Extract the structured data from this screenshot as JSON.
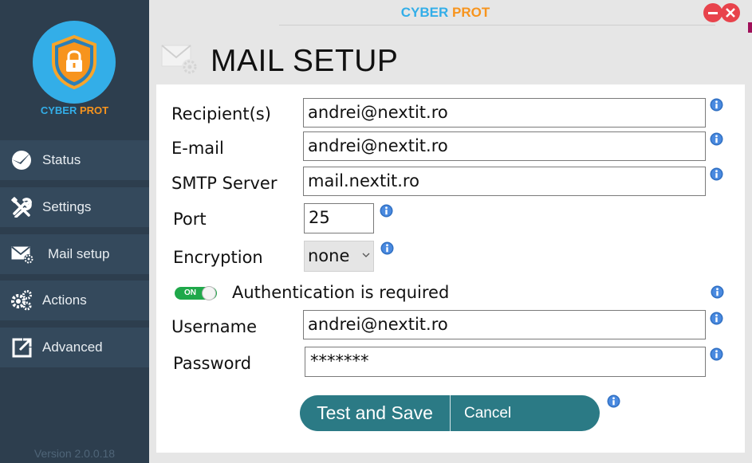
{
  "app": {
    "title_part1": "CYBER",
    "title_part2": "PROT",
    "logo_part1": "CYBER",
    "logo_part2": "PROT",
    "version": "Version 2.0.0.18"
  },
  "sidebar": {
    "items": [
      {
        "label": "Status",
        "icon": "status-check-icon"
      },
      {
        "label": "Settings",
        "icon": "tools-icon"
      },
      {
        "label": "Mail setup",
        "icon": "mail-gear-icon"
      },
      {
        "label": "Actions",
        "icon": "gears-icon"
      },
      {
        "label": "Advanced",
        "icon": "export-icon"
      }
    ]
  },
  "page": {
    "heading": "MAIL SETUP"
  },
  "form": {
    "recipients_label": "Recipient(s)",
    "recipients_value": "andrei@nextit.ro",
    "email_label": "E-mail",
    "email_value": "andrei@nextit.ro",
    "smtp_label": "SMTP Server",
    "smtp_value": "mail.nextit.ro",
    "port_label": "Port",
    "port_value": "25",
    "encryption_label": "Encryption",
    "encryption_value": "none",
    "auth_toggle_text": "ON",
    "auth_label": "Authentication is required",
    "username_label": "Username",
    "username_value": "andrei@nextit.ro",
    "password_label": "Password",
    "password_value": "*******"
  },
  "buttons": {
    "test_save": "Test and Save",
    "cancel": "Cancel"
  },
  "colors": {
    "sidebar": "#2d3e4e",
    "nav_item": "#34495c",
    "brand_blue": "#33aee8",
    "brand_orange": "#f7941d",
    "button": "#2b7a85",
    "toggle_on": "#1fa84a",
    "window_buttons": "#e8434c"
  }
}
